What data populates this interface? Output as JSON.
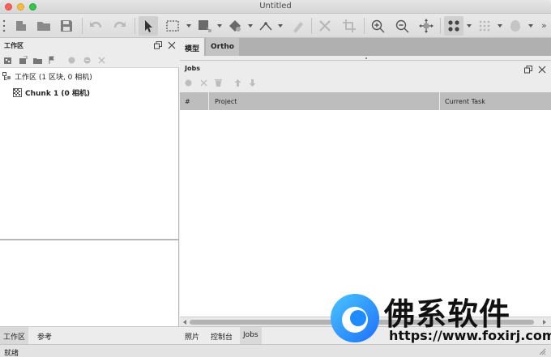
{
  "window": {
    "title": "Untitled"
  },
  "toolbar": {
    "buttons": [
      "grip",
      "new-document",
      "open-folder",
      "save",
      "undo",
      "redo",
      "navigation-select",
      "rectangle-selection",
      "resize-region",
      "rotate-object",
      "ruler-polyline",
      "eraser",
      "delete",
      "crop",
      "zoom-in",
      "zoom-out",
      "reset-view",
      "show-cameras",
      "show-grid",
      "show-model"
    ],
    "overflow_label": "»"
  },
  "workspace": {
    "title": "工作区",
    "root_label": "工作区 (1 区块, 0 相机)",
    "chunk_label": "Chunk 1 (0 相机)"
  },
  "view_tabs": [
    {
      "label": "模型"
    },
    {
      "label": "Ortho"
    }
  ],
  "jobs": {
    "title": "Jobs",
    "columns": [
      {
        "label": "#"
      },
      {
        "label": "Project"
      },
      {
        "label": "Current Task"
      }
    ],
    "rows": []
  },
  "left_bottom_tabs": [
    {
      "label": "工作区"
    },
    {
      "label": "参考"
    }
  ],
  "right_bottom_tabs": [
    {
      "label": "照片"
    },
    {
      "label": "控制台"
    },
    {
      "label": "Jobs"
    }
  ],
  "status": {
    "text": "就绪"
  },
  "watermark": {
    "title": "佛系软件",
    "url": "https://www.foxirj.com"
  },
  "colors": {
    "close": "#fc605b",
    "minimize": "#fdbc40",
    "maximize": "#34c84a",
    "table_header": "#bdbdbd",
    "watermark_blue": "#1ea1ff"
  }
}
